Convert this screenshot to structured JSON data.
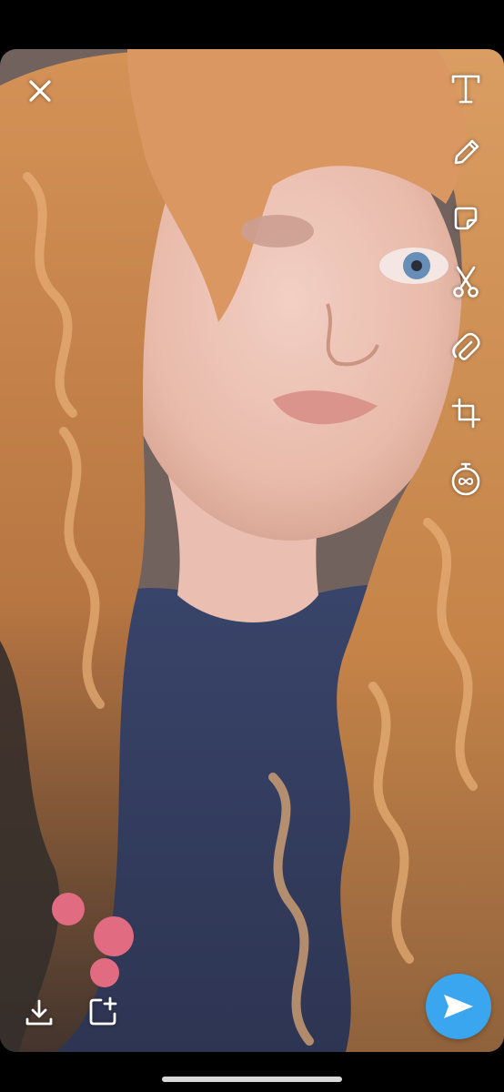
{
  "app": {
    "background": "#000000",
    "accent": "#3aa6ef"
  },
  "photo": {
    "description_free": true
  },
  "top_bar": {
    "close_icon": "close-icon"
  },
  "tool_rail": {
    "items": [
      {
        "icon": "text-tool-icon",
        "glyph": "T"
      },
      {
        "icon": "pencil-icon"
      },
      {
        "icon": "sticker-icon"
      },
      {
        "icon": "scissors-icon"
      },
      {
        "icon": "paperclip-icon"
      },
      {
        "icon": "crop-icon"
      },
      {
        "icon": "timer-icon",
        "glyph": "∞"
      }
    ]
  },
  "bottom_bar": {
    "download_icon": "download-icon",
    "add_story_icon": "add-story-icon",
    "send_icon": "send-arrow-icon"
  }
}
